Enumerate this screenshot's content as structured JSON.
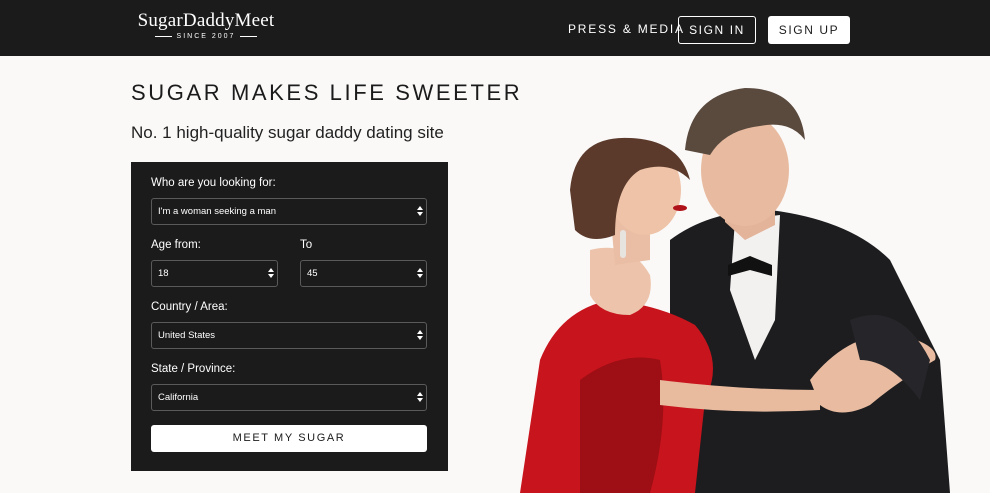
{
  "header": {
    "logo_name": "SugarDaddyMeet",
    "logo_tagline": "SINCE 2007",
    "nav_press": "PRESS & MEDIA",
    "sign_in": "SIGN IN",
    "sign_up": "SIGN UP"
  },
  "hero": {
    "title": "SUGAR MAKES LIFE SWEETER",
    "subtitle": "No. 1 high-quality sugar daddy dating site"
  },
  "search": {
    "looking_for_label": "Who are you looking for:",
    "looking_for_value": "I'm a woman seeking a man",
    "age_from_label": "Age from:",
    "age_from_value": "18",
    "age_to_label": "To",
    "age_to_value": "45",
    "country_label": "Country / Area:",
    "country_value": "United States",
    "state_label": "State / Province:",
    "state_value": "California",
    "submit_label": "MEET MY SUGAR"
  },
  "colors": {
    "header_bg": "#1b1b1b",
    "panel_bg": "#1b1b1b",
    "page_bg": "#faf9f8",
    "dress": "#c8141c"
  }
}
